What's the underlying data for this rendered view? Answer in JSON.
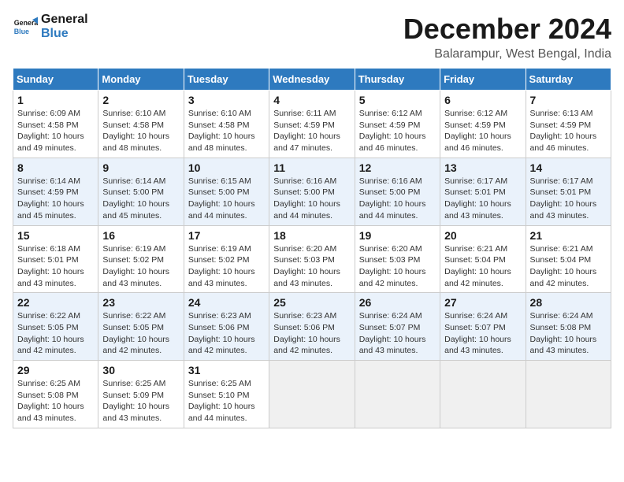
{
  "header": {
    "logo_line1": "General",
    "logo_line2": "Blue",
    "title": "December 2024",
    "subtitle": "Balarampur, West Bengal, India"
  },
  "columns": [
    "Sunday",
    "Monday",
    "Tuesday",
    "Wednesday",
    "Thursday",
    "Friday",
    "Saturday"
  ],
  "weeks": [
    [
      {
        "day": "1",
        "sunrise": "6:09 AM",
        "sunset": "4:58 PM",
        "daylight": "10 hours and 49 minutes."
      },
      {
        "day": "2",
        "sunrise": "6:10 AM",
        "sunset": "4:58 PM",
        "daylight": "10 hours and 48 minutes."
      },
      {
        "day": "3",
        "sunrise": "6:10 AM",
        "sunset": "4:58 PM",
        "daylight": "10 hours and 48 minutes."
      },
      {
        "day": "4",
        "sunrise": "6:11 AM",
        "sunset": "4:59 PM",
        "daylight": "10 hours and 47 minutes."
      },
      {
        "day": "5",
        "sunrise": "6:12 AM",
        "sunset": "4:59 PM",
        "daylight": "10 hours and 46 minutes."
      },
      {
        "day": "6",
        "sunrise": "6:12 AM",
        "sunset": "4:59 PM",
        "daylight": "10 hours and 46 minutes."
      },
      {
        "day": "7",
        "sunrise": "6:13 AM",
        "sunset": "4:59 PM",
        "daylight": "10 hours and 46 minutes."
      }
    ],
    [
      {
        "day": "8",
        "sunrise": "6:14 AM",
        "sunset": "4:59 PM",
        "daylight": "10 hours and 45 minutes."
      },
      {
        "day": "9",
        "sunrise": "6:14 AM",
        "sunset": "5:00 PM",
        "daylight": "10 hours and 45 minutes."
      },
      {
        "day": "10",
        "sunrise": "6:15 AM",
        "sunset": "5:00 PM",
        "daylight": "10 hours and 44 minutes."
      },
      {
        "day": "11",
        "sunrise": "6:16 AM",
        "sunset": "5:00 PM",
        "daylight": "10 hours and 44 minutes."
      },
      {
        "day": "12",
        "sunrise": "6:16 AM",
        "sunset": "5:00 PM",
        "daylight": "10 hours and 44 minutes."
      },
      {
        "day": "13",
        "sunrise": "6:17 AM",
        "sunset": "5:01 PM",
        "daylight": "10 hours and 43 minutes."
      },
      {
        "day": "14",
        "sunrise": "6:17 AM",
        "sunset": "5:01 PM",
        "daylight": "10 hours and 43 minutes."
      }
    ],
    [
      {
        "day": "15",
        "sunrise": "6:18 AM",
        "sunset": "5:01 PM",
        "daylight": "10 hours and 43 minutes."
      },
      {
        "day": "16",
        "sunrise": "6:19 AM",
        "sunset": "5:02 PM",
        "daylight": "10 hours and 43 minutes."
      },
      {
        "day": "17",
        "sunrise": "6:19 AM",
        "sunset": "5:02 PM",
        "daylight": "10 hours and 43 minutes."
      },
      {
        "day": "18",
        "sunrise": "6:20 AM",
        "sunset": "5:03 PM",
        "daylight": "10 hours and 43 minutes."
      },
      {
        "day": "19",
        "sunrise": "6:20 AM",
        "sunset": "5:03 PM",
        "daylight": "10 hours and 42 minutes."
      },
      {
        "day": "20",
        "sunrise": "6:21 AM",
        "sunset": "5:04 PM",
        "daylight": "10 hours and 42 minutes."
      },
      {
        "day": "21",
        "sunrise": "6:21 AM",
        "sunset": "5:04 PM",
        "daylight": "10 hours and 42 minutes."
      }
    ],
    [
      {
        "day": "22",
        "sunrise": "6:22 AM",
        "sunset": "5:05 PM",
        "daylight": "10 hours and 42 minutes."
      },
      {
        "day": "23",
        "sunrise": "6:22 AM",
        "sunset": "5:05 PM",
        "daylight": "10 hours and 42 minutes."
      },
      {
        "day": "24",
        "sunrise": "6:23 AM",
        "sunset": "5:06 PM",
        "daylight": "10 hours and 42 minutes."
      },
      {
        "day": "25",
        "sunrise": "6:23 AM",
        "sunset": "5:06 PM",
        "daylight": "10 hours and 42 minutes."
      },
      {
        "day": "26",
        "sunrise": "6:24 AM",
        "sunset": "5:07 PM",
        "daylight": "10 hours and 43 minutes."
      },
      {
        "day": "27",
        "sunrise": "6:24 AM",
        "sunset": "5:07 PM",
        "daylight": "10 hours and 43 minutes."
      },
      {
        "day": "28",
        "sunrise": "6:24 AM",
        "sunset": "5:08 PM",
        "daylight": "10 hours and 43 minutes."
      }
    ],
    [
      {
        "day": "29",
        "sunrise": "6:25 AM",
        "sunset": "5:08 PM",
        "daylight": "10 hours and 43 minutes."
      },
      {
        "day": "30",
        "sunrise": "6:25 AM",
        "sunset": "5:09 PM",
        "daylight": "10 hours and 43 minutes."
      },
      {
        "day": "31",
        "sunrise": "6:25 AM",
        "sunset": "5:10 PM",
        "daylight": "10 hours and 44 minutes."
      },
      null,
      null,
      null,
      null
    ]
  ],
  "labels": {
    "sunrise": "Sunrise:",
    "sunset": "Sunset:",
    "daylight": "Daylight:"
  }
}
